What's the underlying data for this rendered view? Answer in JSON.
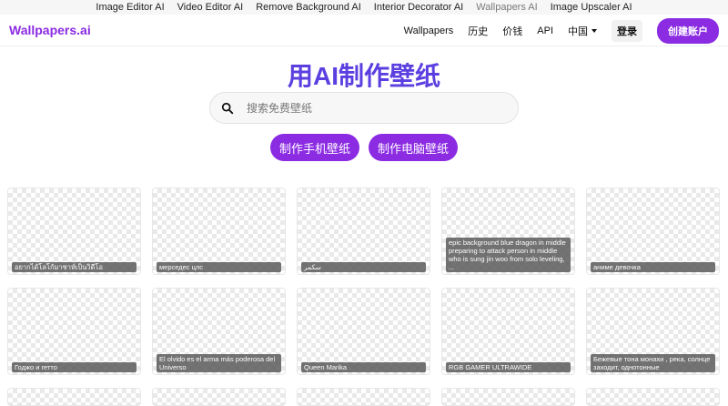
{
  "topbar": {
    "items": [
      "Image Editor AI",
      "Video Editor AI",
      "Remove Background AI",
      "Interior Decorator AI",
      "Wallpapers AI",
      "Image Upscaler AI"
    ],
    "active_index": 4
  },
  "nav": {
    "brand": "Wallpapers.ai",
    "links": [
      "Wallpapers",
      "历史",
      "价钱",
      "API"
    ],
    "region": "中国",
    "login": "登录",
    "signup": "创建账户"
  },
  "hero": {
    "title": "用AI制作壁纸"
  },
  "search": {
    "placeholder": "搜索免费壁纸",
    "value": ""
  },
  "cta": {
    "phone": "制作手机壁纸",
    "pc": "制作电脑壁纸"
  },
  "cards": [
    "อยากได้โลโก้มาชาห์เป็นวิดีโอ",
    "мерседес цлс",
    "سكمر",
    "epic background blue dragon in middle preparing to attack person in middle who is sung jin woo from solo leveling, ...",
    "аниме девочка",
    "Годжо и гетто",
    "El olvido es el arma más poderosa del Universo",
    "Queen Marika",
    "RGB GAMER ULTRAWIDE",
    "Бежевые тона монахи , река, солнце заходит, однотонные"
  ],
  "colors": {
    "brand": "#8b2be2",
    "hero": "#5c3fe0"
  }
}
